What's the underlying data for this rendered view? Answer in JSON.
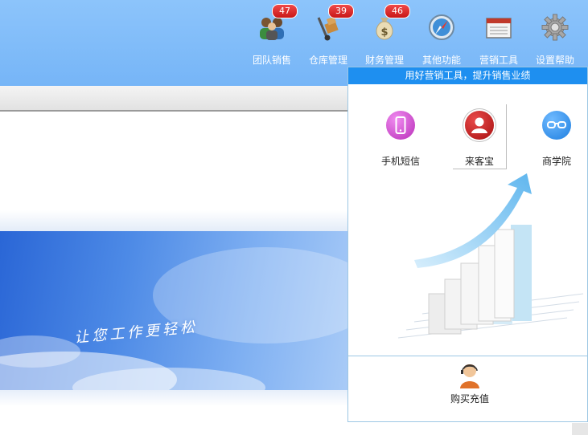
{
  "nav": {
    "items": [
      {
        "label": "团队销售",
        "icon": "team-users-icon",
        "badge": "47"
      },
      {
        "label": "仓库管理",
        "icon": "hand-truck-icon",
        "badge": "39"
      },
      {
        "label": "财务管理",
        "icon": "money-bag-icon",
        "badge": "46"
      },
      {
        "label": "其他功能",
        "icon": "compass-icon",
        "badge": null
      },
      {
        "label": "营销工具",
        "icon": "calendar-icon",
        "badge": null
      },
      {
        "label": "设置帮助",
        "icon": "gear-icon",
        "badge": null
      }
    ]
  },
  "banner": {
    "slogan": "让您工作更轻松"
  },
  "marketing_panel": {
    "header": "用好营销工具，提升销售业绩",
    "tools": [
      {
        "label": "手机短信",
        "icon": "mobile-phone-icon",
        "color": "#d44bd4"
      },
      {
        "label": "来客宝",
        "icon": "person-icon",
        "color": "#c81e1e"
      },
      {
        "label": "商学院",
        "icon": "glasses-icon",
        "color": "#2f8ff0"
      }
    ],
    "buy_label": "购买充值"
  },
  "colors": {
    "header_bg": "#80bcf9",
    "panel_header": "#1e8ff0",
    "badge": "#d82424"
  }
}
